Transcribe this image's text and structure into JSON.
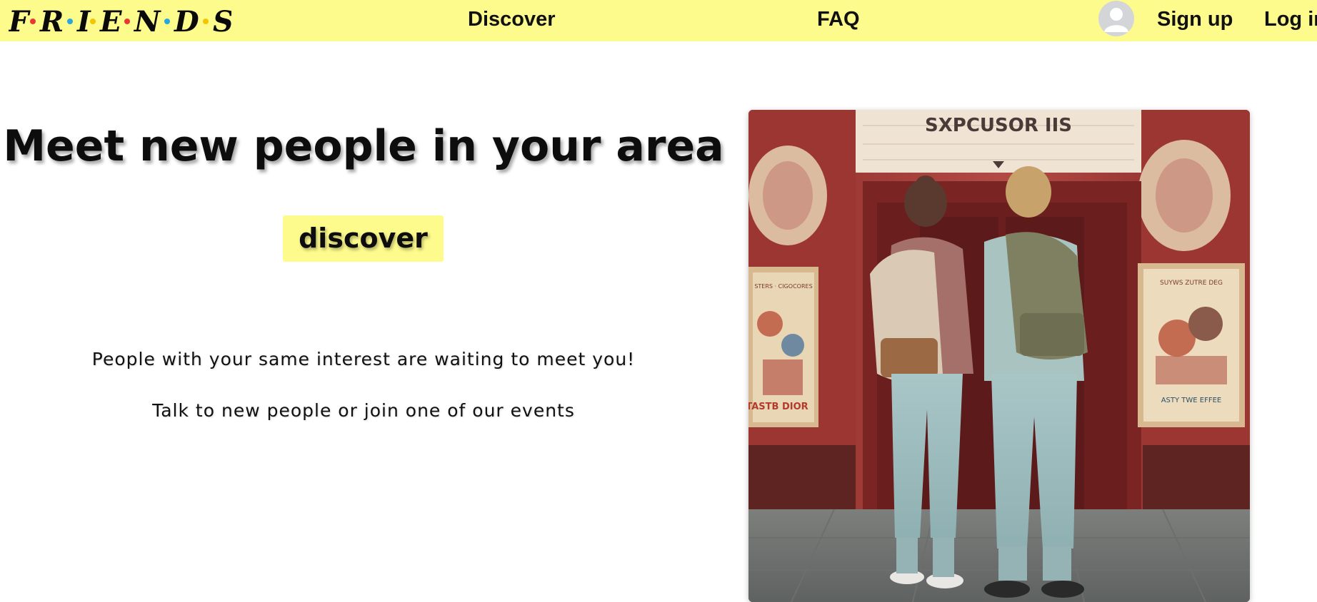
{
  "logo": {
    "letters": [
      "F",
      "R",
      "I",
      "E",
      "N",
      "D",
      "S"
    ],
    "dot_colors": [
      "#e8382f",
      "#2aa7d8",
      "#f4c400",
      "#e8382f",
      "#2aa7d8",
      "#f4c400"
    ]
  },
  "nav": {
    "discover_label": "Discover",
    "faq_label": "FAQ",
    "signup_label": "Sign up",
    "login_label": "Log in"
  },
  "hero": {
    "title": "Meet new people in your area",
    "button_label": "discover",
    "tagline_1": "People with your same interest are waiting to meet you!",
    "tagline_2": "Talk to new people or join one of our events"
  },
  "image": {
    "marquee_text": "SXPCUSOR IIS",
    "poster_left_top": "STERS · CIGOCORES",
    "poster_left_bottom": "TASTB DIOR",
    "poster_right_top": "SUYWS ZUTRE DEG",
    "poster_right_bottom": "ASTY TWE EFFEE"
  },
  "colors": {
    "accent_yellow": "#fdfb8c",
    "text": "#111111"
  }
}
